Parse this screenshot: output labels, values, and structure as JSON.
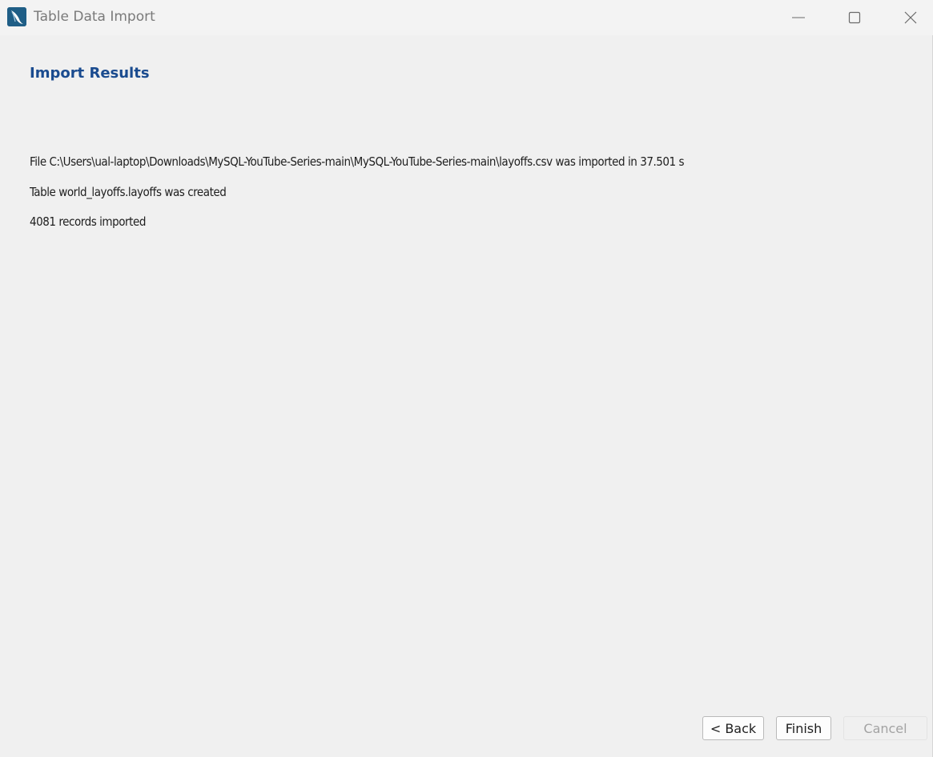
{
  "window": {
    "title": "Table Data Import",
    "icon": "mysql-workbench-dolphin-icon",
    "controls": [
      "minimize-icon",
      "maximize-icon",
      "close-icon"
    ]
  },
  "page": {
    "heading": "Import Results",
    "results": [
      "File C:\\Users\\ual-laptop\\Downloads\\MySQL-YouTube-Series-main\\MySQL-YouTube-Series-main\\layoffs.csv was imported in 37.501 s",
      "Table world_layoffs.layoffs was created",
      "4081 records imported"
    ]
  },
  "buttons": {
    "back": "< Back",
    "finish": "Finish",
    "cancel": "Cancel"
  },
  "colors": {
    "heading": "#1a4b8f",
    "background": "#f0f0f0",
    "app_icon": "#1f5e86"
  }
}
